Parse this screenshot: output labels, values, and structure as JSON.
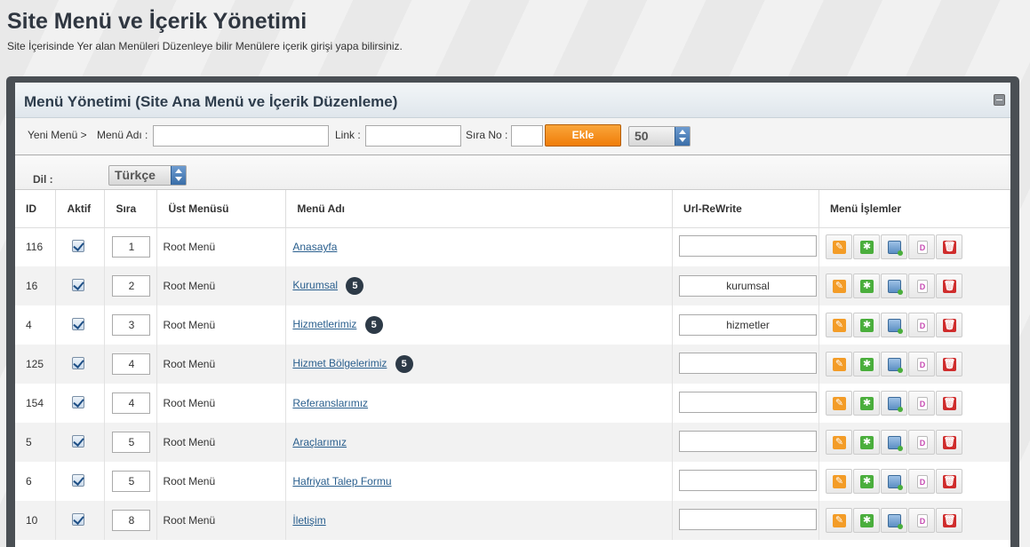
{
  "header": {
    "title": "Site Menü ve İçerik Yönetimi",
    "subtitle": "Site İçerisinde Yer alan Menüleri Düzenleye bilir Menülere içerik girişi yapa bilirsiniz."
  },
  "panel": {
    "title": "Menü Yönetimi (Site Ana Menü ve İçerik Düzenleme)"
  },
  "new_menu": {
    "prefix_label": "Yeni Menü >",
    "name_label": "Menü Adı :",
    "name_value": "",
    "link_label": "Link :",
    "link_value": "",
    "order_label": "Sıra No :",
    "order_value": "",
    "add_label": "Ekle",
    "page_size": "50"
  },
  "language": {
    "label": "Dil :",
    "selected": "Türkçe"
  },
  "table": {
    "headers": {
      "id": "ID",
      "active": "Aktif",
      "order": "Sıra",
      "parent": "Üst Menüsü",
      "name": "Menü Adı",
      "url": "Url-ReWrite",
      "actions": "Menü İşlemler"
    },
    "rows": [
      {
        "id": "116",
        "active": true,
        "order": "1",
        "parent": "Root Menü",
        "name": "Anasayfa",
        "badge": "",
        "url": ""
      },
      {
        "id": "16",
        "active": true,
        "order": "2",
        "parent": "Root Menü",
        "name": "Kurumsal",
        "badge": "5",
        "url": "kurumsal"
      },
      {
        "id": "4",
        "active": true,
        "order": "3",
        "parent": "Root Menü",
        "name": "Hizmetlerimiz",
        "badge": "5",
        "url": "hizmetler"
      },
      {
        "id": "125",
        "active": true,
        "order": "4",
        "parent": "Root Menü",
        "name": "Hizmet Bölgelerimiz",
        "badge": "5",
        "url": ""
      },
      {
        "id": "154",
        "active": true,
        "order": "4",
        "parent": "Root Menü",
        "name": "Referanslarımız",
        "badge": "",
        "url": ""
      },
      {
        "id": "5",
        "active": true,
        "order": "5",
        "parent": "Root Menü",
        "name": "Araçlarımız",
        "badge": "",
        "url": ""
      },
      {
        "id": "6",
        "active": true,
        "order": "5",
        "parent": "Root Menü",
        "name": "Hafriyat Talep Formu",
        "badge": "",
        "url": ""
      },
      {
        "id": "10",
        "active": true,
        "order": "8",
        "parent": "Root Menü",
        "name": "İletişim",
        "badge": "",
        "url": ""
      }
    ],
    "action_icons": [
      "edit-icon",
      "add-content-icon",
      "gallery-icon",
      "document-icon",
      "delete-icon"
    ],
    "doc_icon_glyph": "D"
  },
  "colors": {
    "accent_orange": "#f07d09",
    "link_blue": "#2a5f8e",
    "badge_dark": "#2d3a47",
    "panel_frame": "#4a4f54"
  }
}
